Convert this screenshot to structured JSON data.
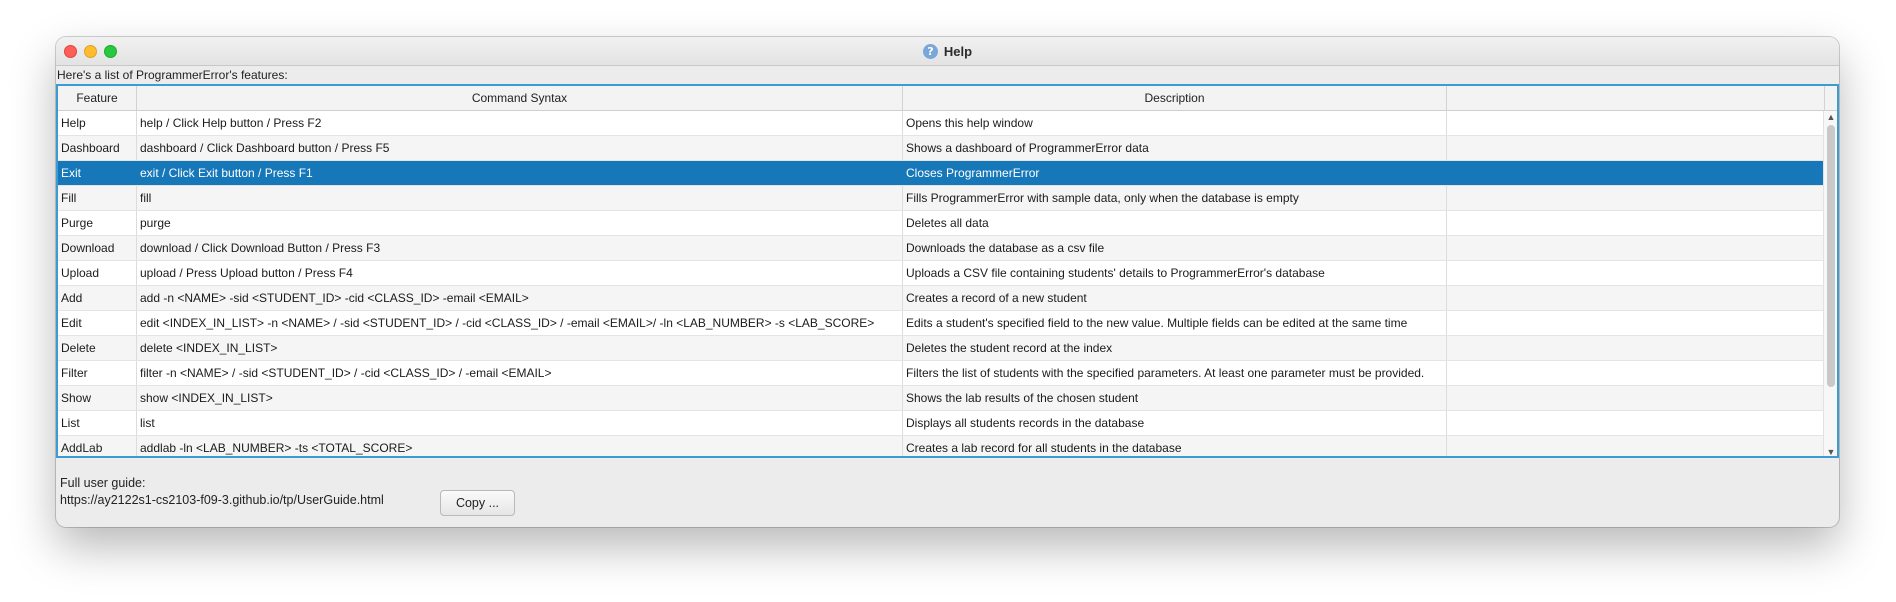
{
  "window": {
    "title": "Help",
    "intro": "Here's a list of ProgrammerError's features:"
  },
  "table": {
    "headers": [
      "Feature",
      "Command Syntax",
      "Description",
      ""
    ],
    "selected_index": 2,
    "rows": [
      [
        "Help",
        "help / Click Help button / Press F2",
        "Opens this help window",
        ""
      ],
      [
        "Dashboard",
        "dashboard / Click Dashboard button / Press F5",
        "Shows a dashboard of ProgrammerError data",
        ""
      ],
      [
        "Exit",
        "exit / Click Exit button / Press F1",
        "Closes ProgrammerError",
        ""
      ],
      [
        "Fill",
        "fill",
        "Fills ProgrammerError with sample data, only when the database is empty",
        ""
      ],
      [
        "Purge",
        "purge",
        "Deletes all data",
        ""
      ],
      [
        "Download",
        "download / Click Download Button / Press F3",
        "Downloads the database as a csv file",
        ""
      ],
      [
        "Upload",
        "upload / Press Upload button / Press F4",
        "Uploads a CSV file containing students' details to ProgrammerError's database",
        ""
      ],
      [
        "Add",
        "add -n <NAME> -sid <STUDENT_ID> -cid <CLASS_ID> -email <EMAIL>",
        "Creates a record of a new student",
        ""
      ],
      [
        "Edit",
        "edit <INDEX_IN_LIST> -n <NAME> / -sid <STUDENT_ID> / -cid <CLASS_ID> / -email <EMAIL>/ -ln <LAB_NUMBER> -s <LAB_SCORE>",
        "Edits a student's specified field to the new value. Multiple fields can be edited at the same time",
        ""
      ],
      [
        "Delete",
        "delete <INDEX_IN_LIST>",
        "Deletes the student record at the index",
        ""
      ],
      [
        "Filter",
        "filter -n <NAME> / -sid <STUDENT_ID> / -cid <CLASS_ID> / -email <EMAIL>",
        "Filters the list of students with the specified parameters. At least one parameter must be provided.",
        ""
      ],
      [
        "Show",
        "show <INDEX_IN_LIST>",
        "Shows the lab results of the chosen student",
        ""
      ],
      [
        "List",
        "list",
        "Displays all students records in the database",
        ""
      ],
      [
        "AddLab",
        "addlab -ln <LAB_NUMBER> -ts <TOTAL_SCORE>",
        "Creates a lab record for all students in the database",
        ""
      ]
    ]
  },
  "footer": {
    "guide_label": "Full user guide:",
    "guide_url": "https://ay2122s1-cs2103-f09-3.github.io/tp/UserGuide.html",
    "copy_label": "Copy ..."
  }
}
